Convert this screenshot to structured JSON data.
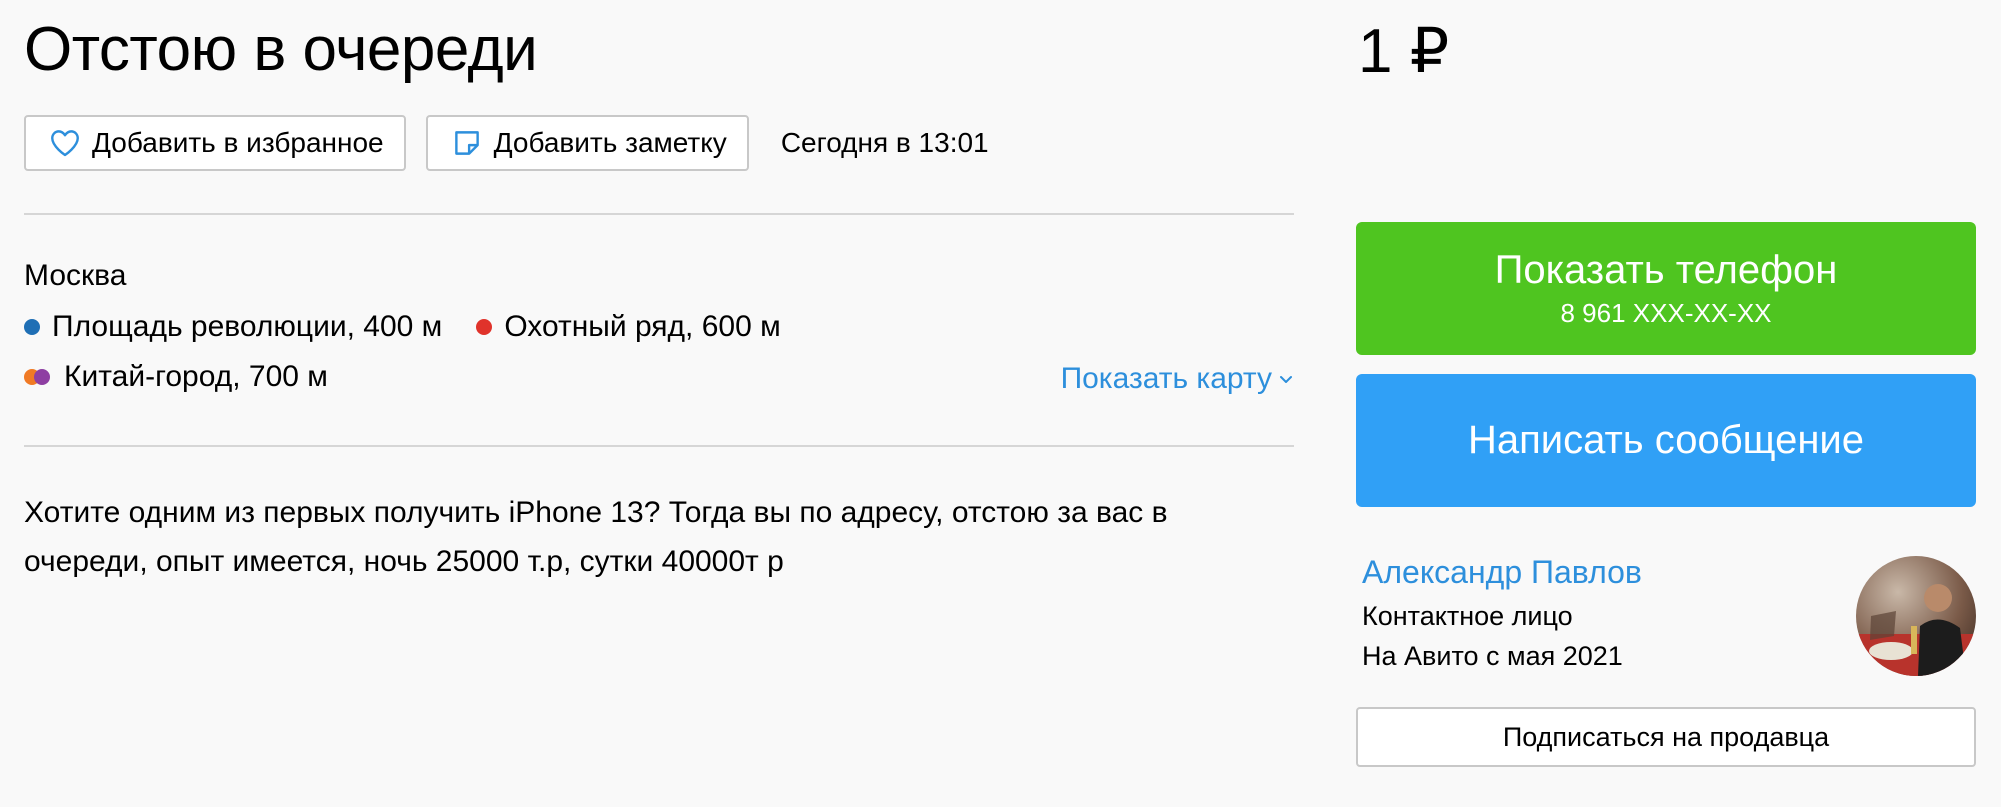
{
  "listing": {
    "title": "Отстою в очереди",
    "price": "1 ₽",
    "date": "Сегодня в 13:01",
    "description": "Хотите одним из первых получить iPhone 13? Тогда вы по адресу, отстою за вас в очереди, опыт имеется, ночь 25000 т.р, сутки 40000т р"
  },
  "actions": {
    "favorite_label": "Добавить в избранное",
    "note_label": "Добавить заметку"
  },
  "location": {
    "city": "Москва",
    "metro": [
      {
        "name": "Площадь революции, 400 м",
        "color": "#1f6fb5"
      },
      {
        "name": "Охотный ряд, 600 м",
        "color": "#e0332b"
      },
      {
        "name": "Китай-город, 700 м",
        "colors": [
          "#f07a25",
          "#8e3fa2"
        ]
      }
    ],
    "show_map_label": "Показать карту"
  },
  "contact": {
    "show_phone_label": "Показать телефон",
    "phone_masked": "8 961 XXX-XX-XX",
    "message_label": "Написать сообщение",
    "subscribe_label": "Подписаться на продавца"
  },
  "seller": {
    "name": "Александр Павлов",
    "role": "Контактное лицо",
    "since": "На Авито с мая 2021"
  },
  "colors": {
    "green_button": "#4fc520",
    "blue_button": "#30a0f6",
    "link": "#2d8fdc",
    "icon": "#2d8fdc"
  },
  "icons": {
    "favorite": "heart-icon",
    "note": "note-icon",
    "map": "chevron-down-icon"
  }
}
